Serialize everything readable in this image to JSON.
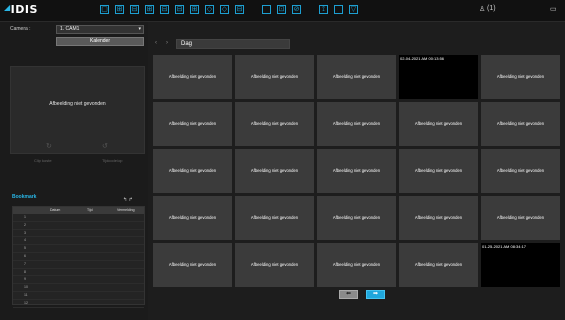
{
  "app": {
    "logo": "IDIS"
  },
  "toolbar": {
    "icons": [
      "layout-1-icon",
      "layout-4-icon",
      "layout-9-icon",
      "layout-16-icon",
      "layout-6-icon",
      "layout-8-icon",
      "layout-13-icon",
      "zoom-icon",
      "zoom-out-icon",
      "panorama-icon",
      "export-icon",
      "search-icon",
      "bookmark-icon",
      "filter-icon",
      "view-icon",
      "play-icon"
    ],
    "right": {
      "camera_status": "(1)",
      "window_icon": "window-icon"
    }
  },
  "left": {
    "camera_label": "Camera :",
    "camera_value": "1. CAM1",
    "calendar_button": "Kalender",
    "preview_text": "Afbeelding niet gevonden",
    "clip_label": "Clip koste",
    "timecode_label": "Tijdcode/op",
    "bookmark_title": "Bookmark",
    "bookmark_headers": [
      "Datum",
      "Tijd",
      "Vermelding"
    ],
    "bookmark_rows": [
      "1",
      "2",
      "3",
      "4",
      "5",
      "6",
      "7",
      "8",
      "9",
      "10",
      "11",
      "12"
    ]
  },
  "main": {
    "view_label": "Dag",
    "grid": [
      {
        "text": "Afbeelding niet gevonden"
      },
      {
        "text": "Afbeelding niet gevonden"
      },
      {
        "text": "Afbeelding niet gevonden"
      },
      {
        "timestamp": "02-04-2021  AM 00:13:56",
        "black": true
      },
      {
        "text": "Afbeelding niet gevonden"
      },
      {
        "text": "Afbeelding niet gevonden"
      },
      {
        "text": "Afbeelding niet gevonden"
      },
      {
        "text": "Afbeelding niet gevonden"
      },
      {
        "text": "Afbeelding niet gevonden"
      },
      {
        "text": "Afbeelding niet gevonden"
      },
      {
        "text": "Afbeelding niet gevonden"
      },
      {
        "text": "Afbeelding niet gevonden"
      },
      {
        "text": "Afbeelding niet gevonden"
      },
      {
        "text": "Afbeelding niet gevonden"
      },
      {
        "text": "Afbeelding niet gevonden"
      },
      {
        "text": "Afbeelding niet gevonden"
      },
      {
        "text": "Afbeelding niet gevonden"
      },
      {
        "text": "Afbeelding niet gevonden"
      },
      {
        "text": "Afbeelding niet gevonden"
      },
      {
        "text": "Afbeelding niet gevonden"
      },
      {
        "text": "Afbeelding niet gevonden"
      },
      {
        "text": "Afbeelding niet gevonden"
      },
      {
        "text": "Afbeelding niet gevonden"
      },
      {
        "text": "Afbeelding niet gevonden"
      },
      {
        "timestamp": "01-25-2021  AM 08:34:17",
        "black": true
      }
    ]
  },
  "colors": {
    "accent": "#1fa7dd",
    "cell": "#3b3b3b"
  }
}
